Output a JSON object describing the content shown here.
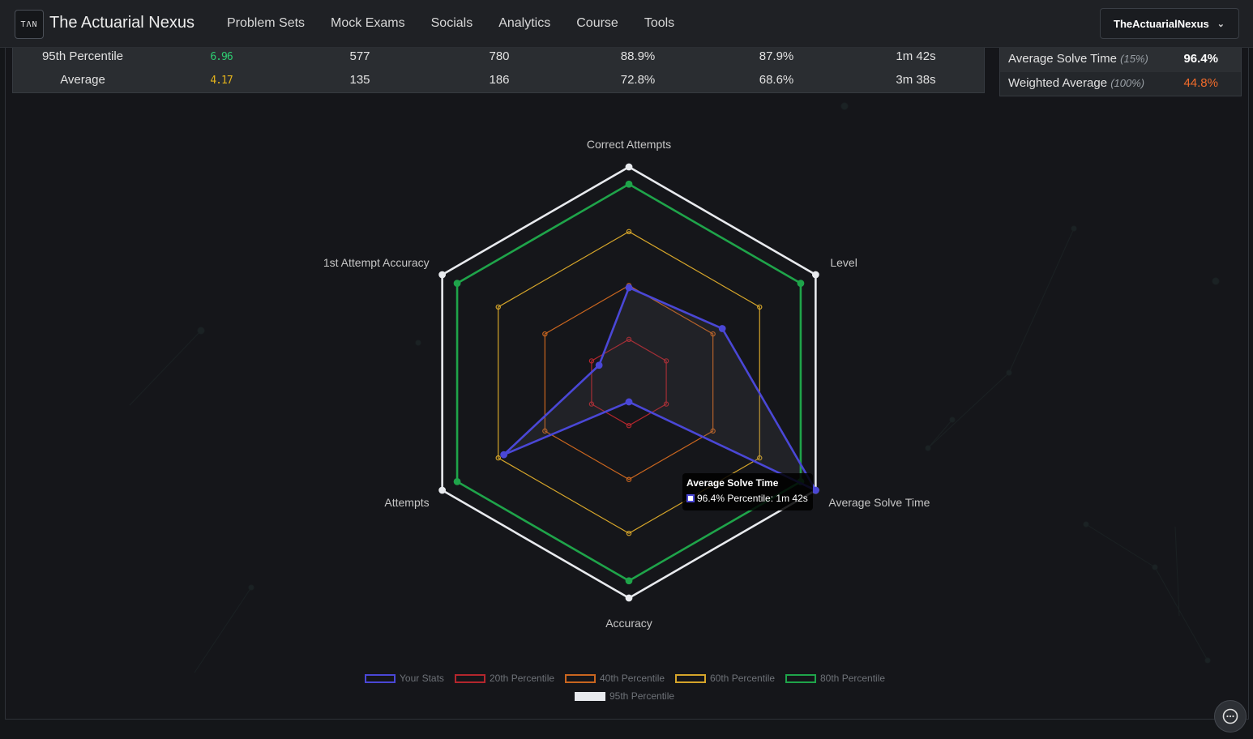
{
  "header": {
    "logo_text": "TΛN",
    "brand": "The Actuarial Nexus",
    "nav": [
      "Problem Sets",
      "Mock Exams",
      "Socials",
      "Analytics",
      "Course",
      "Tools"
    ],
    "user": "TheActuarialNexus"
  },
  "stats_table": {
    "rows": [
      {
        "label": "95th Percentile",
        "level": "6.96",
        "level_color": "#2ecc71",
        "c1": "577",
        "c2": "780",
        "c3": "88.9%",
        "c4": "87.9%",
        "c5": "1m 42s"
      },
      {
        "label": "Average",
        "level": "4.17",
        "level_color": "#e3b21c",
        "c1": "135",
        "c2": "186",
        "c3": "72.8%",
        "c4": "68.6%",
        "c5": "3m 38s"
      }
    ]
  },
  "weights": {
    "rows": [
      {
        "label": "Average Solve Time",
        "weight": "(15%)",
        "value": "96.4%",
        "color": "#ffffff"
      },
      {
        "label": "Weighted Average",
        "weight": "(100%)",
        "value": "44.8%",
        "color": "#f26b2a"
      }
    ]
  },
  "chart_data": {
    "type": "radar",
    "axes": [
      "Correct Attempts",
      "Level",
      "Average Solve Time",
      "Accuracy",
      "Attempts",
      "1st Attempt Accuracy"
    ],
    "range": [
      0,
      100
    ],
    "series": [
      {
        "name": "Your Stats",
        "color": "#4a47d6",
        "values": [
          44,
          50,
          100,
          9,
          67,
          16
        ]
      },
      {
        "name": "20th Percentile",
        "color": "#b3262d",
        "values": [
          20,
          20,
          20,
          20,
          20,
          20
        ]
      },
      {
        "name": "40th Percentile",
        "color": "#c8651f",
        "values": [
          45,
          45,
          45,
          45,
          45,
          45
        ]
      },
      {
        "name": "60th Percentile",
        "color": "#d4a42a",
        "values": [
          70,
          70,
          70,
          70,
          70,
          70
        ]
      },
      {
        "name": "80th Percentile",
        "color": "#1fa44a",
        "values": [
          92,
          92,
          92,
          92,
          92,
          92
        ]
      },
      {
        "name": "95th Percentile",
        "color": "#e8eaee",
        "values": [
          100,
          100,
          100,
          100,
          100,
          100
        ]
      }
    ],
    "tooltip": {
      "title": "Average Solve Time",
      "text": "96.4% Percentile: 1m 42s"
    }
  }
}
